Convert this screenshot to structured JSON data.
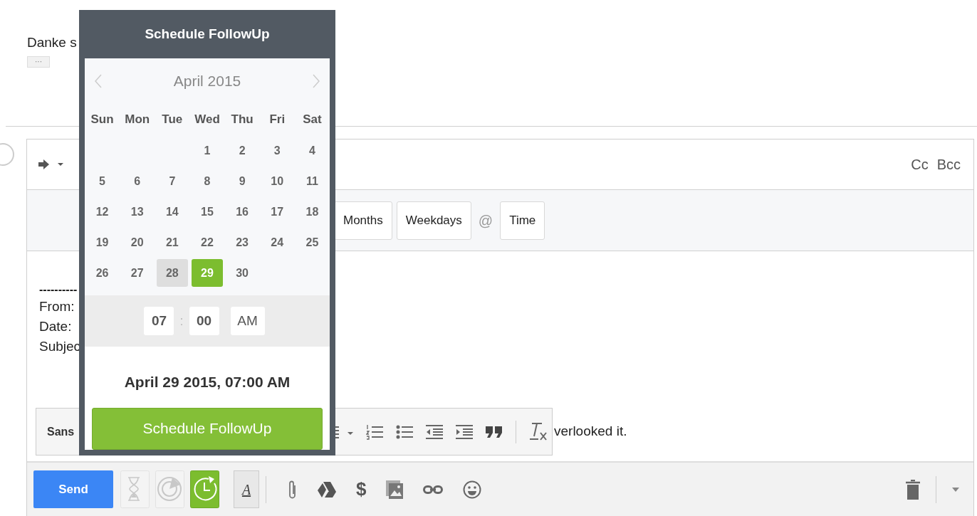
{
  "thread": {
    "text": "Danke s",
    "ellipsis": "···"
  },
  "compose": {
    "cc": "Cc",
    "bcc": "Bcc",
    "schedule_options": [
      {
        "kind": "button",
        "label": "Months"
      },
      {
        "kind": "button",
        "label": "Weekdays"
      },
      {
        "kind": "symbol",
        "label": "@"
      },
      {
        "kind": "button",
        "label": "Time"
      }
    ],
    "body": {
      "separator": "----------",
      "lines": [
        "From:",
        "Date:",
        "Subjec"
      ],
      "trailing_text": "verlooked it."
    },
    "format_toolbar": {
      "font": "Sans"
    },
    "bottom_bar": {
      "send": "Send",
      "tools": [
        {
          "kind": "hourglass",
          "active": false
        },
        {
          "kind": "radar",
          "active": false
        },
        {
          "kind": "clock",
          "active": true
        }
      ],
      "text_format": "A",
      "currency": "$"
    }
  },
  "popup": {
    "title": "Schedule FollowUp",
    "month": "April 2015",
    "weekdays": [
      "Sun",
      "Mon",
      "Tue",
      "Wed",
      "Thu",
      "Fri",
      "Sat"
    ],
    "weeks": [
      [
        {
          "day": "1",
          "today": false,
          "selected": false
        },
        {
          "day": "2",
          "today": false,
          "selected": false
        },
        {
          "day": "3",
          "today": false,
          "selected": false
        },
        {
          "day": "4",
          "today": false,
          "selected": false
        }
      ],
      [
        {
          "day": "5",
          "today": false,
          "selected": false
        },
        {
          "day": "6",
          "today": false,
          "selected": false
        },
        {
          "day": "7",
          "today": false,
          "selected": false
        },
        {
          "day": "8",
          "today": false,
          "selected": false
        },
        {
          "day": "9",
          "today": false,
          "selected": false
        },
        {
          "day": "10",
          "today": false,
          "selected": false
        },
        {
          "day": "11",
          "today": false,
          "selected": false
        }
      ],
      [
        {
          "day": "12",
          "today": false,
          "selected": false
        },
        {
          "day": "13",
          "today": false,
          "selected": false
        },
        {
          "day": "14",
          "today": false,
          "selected": false
        },
        {
          "day": "15",
          "today": false,
          "selected": false
        },
        {
          "day": "16",
          "today": false,
          "selected": false
        },
        {
          "day": "17",
          "today": false,
          "selected": false
        },
        {
          "day": "18",
          "today": false,
          "selected": false
        }
      ],
      [
        {
          "day": "19",
          "today": false,
          "selected": false
        },
        {
          "day": "20",
          "today": false,
          "selected": false
        },
        {
          "day": "21",
          "today": false,
          "selected": false
        },
        {
          "day": "22",
          "today": false,
          "selected": false
        },
        {
          "day": "23",
          "today": false,
          "selected": false
        },
        {
          "day": "24",
          "today": false,
          "selected": false
        },
        {
          "day": "25",
          "today": false,
          "selected": false
        }
      ],
      [
        {
          "day": "26",
          "today": false,
          "selected": false
        },
        {
          "day": "27",
          "today": false,
          "selected": false
        },
        {
          "day": "28",
          "today": true,
          "selected": false
        },
        {
          "day": "29",
          "today": false,
          "selected": true
        },
        {
          "day": "30",
          "today": false,
          "selected": false
        }
      ]
    ],
    "time": {
      "hour": "07",
      "separator": ":",
      "minute": "00",
      "period": "AM"
    },
    "summary": "April 29 2015, 07:00 AM",
    "button": "Schedule FollowUp"
  }
}
